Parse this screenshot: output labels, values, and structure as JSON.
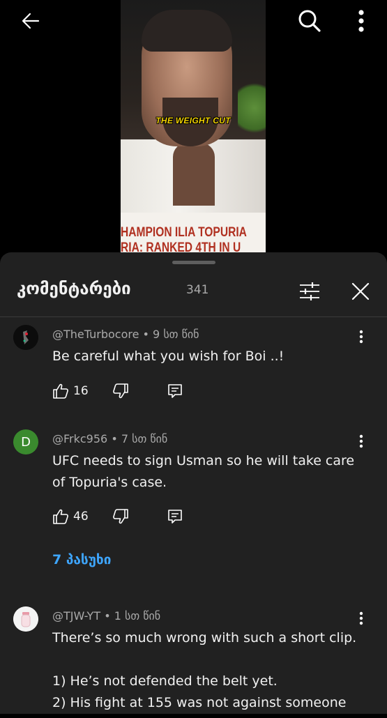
{
  "video": {
    "caption": "THE WEIGHT CUT",
    "banner_line1": "HAMPION ILIA TOPURIA",
    "banner_line2": "RIA: RANKED 4TH IN U"
  },
  "topbar": {
    "back_icon": "arrow-left-icon",
    "search_icon": "search-icon",
    "more_icon": "more-vert-icon"
  },
  "sheet": {
    "title": "კომენტარები",
    "count": "341",
    "filter_icon": "sliders-icon",
    "close_icon": "close-icon"
  },
  "comments": [
    {
      "author": "@TheTurbocore",
      "time": "9 სთ წინ",
      "text": "Be careful what you wish for Boi ..!",
      "likes": "16",
      "avatar": "image"
    },
    {
      "author": "@Frkc956",
      "time": "7 სთ წინ",
      "text_lines": [
        "UFC needs to sign Usman so he will take care",
        "of Topuria's case."
      ],
      "likes": "46",
      "avatar_letter": "D",
      "avatar_color": "#3a8a2e",
      "replies_label": "7 პასუხი"
    },
    {
      "author": "@TJW-YT",
      "time": "1 სთ წინ",
      "text_lines": [
        "There’s so much wrong with such a short clip.",
        "",
        "1) He’s not defended the belt yet.",
        "2) His fight at 155 was not against someone"
      ],
      "avatar": "image"
    }
  ]
}
